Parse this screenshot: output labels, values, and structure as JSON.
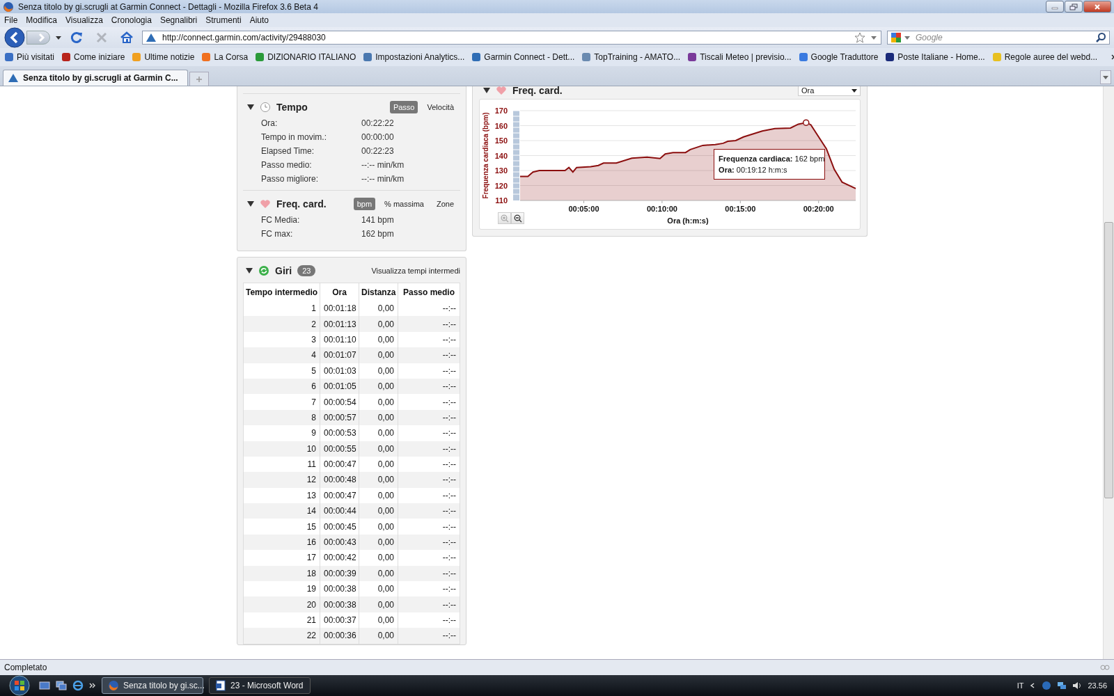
{
  "window": {
    "title": "Senza titolo by gi.scrugli at Garmin Connect - Dettagli - Mozilla Firefox 3.6 Beta 4"
  },
  "menu": [
    "File",
    "Modifica",
    "Visualizza",
    "Cronologia",
    "Segnalibri",
    "Strumenti",
    "Aiuto"
  ],
  "nav": {
    "url": "http://connect.garmin.com/activity/29488030",
    "search_placeholder": "Google"
  },
  "bookmarks": [
    {
      "label": "Più visitati",
      "color": "#3a6fc4"
    },
    {
      "label": "Come iniziare",
      "color": "#b8241c"
    },
    {
      "label": "Ultime notizie",
      "color": "#f0a020"
    },
    {
      "label": "La Corsa",
      "color": "#f07020"
    },
    {
      "label": "DIZIONARIO ITALIANO",
      "color": "#2a9a3a"
    },
    {
      "label": "Impostazioni Analytics...",
      "color": "#4a78b0"
    },
    {
      "label": "Garmin Connect - Dett...",
      "color": "#2f6db5"
    },
    {
      "label": "TopTraining - AMATO...",
      "color": "#6a8ab0"
    },
    {
      "label": "Tiscali Meteo | previsio...",
      "color": "#7a3a9a"
    },
    {
      "label": "Google Traduttore",
      "color": "#3a7ae0"
    },
    {
      "label": "Poste Italiane - Home...",
      "color": "#1a2a7a"
    },
    {
      "label": "Regole auree del webd...",
      "color": "#e8c020"
    }
  ],
  "tabs": [
    {
      "label": "Senza titolo by gi.scrugli at Garmin C...",
      "selected": true
    }
  ],
  "summary": [
    {
      "title": "Tempo",
      "kind": "clock",
      "expanded": true,
      "toggles": [
        {
          "label": "Passo",
          "selected": true
        },
        {
          "label": "Velocità",
          "selected": false
        }
      ],
      "rows": [
        {
          "label": "Ora:",
          "value": "00:22:22"
        },
        {
          "label": "Tempo in movim.:",
          "value": "00:00:00"
        },
        {
          "label": "Elapsed Time:",
          "value": "00:22:23"
        },
        {
          "label": "Passo medio:",
          "value": "--:-- min/km"
        },
        {
          "label": "Passo migliore:",
          "value": "--:-- min/km"
        }
      ]
    },
    {
      "title": "Freq. card.",
      "kind": "heart",
      "expanded": true,
      "toggles": [
        {
          "label": "bpm",
          "selected": true
        },
        {
          "label": "% massima",
          "selected": false
        },
        {
          "label": "Zone",
          "selected": false
        }
      ],
      "rows": [
        {
          "label": "FC Media:",
          "value": "141 bpm"
        },
        {
          "label": "FC max:",
          "value": "162 bpm"
        }
      ]
    }
  ],
  "chart_panel": {
    "title": "Freq. card.",
    "kind": "heart",
    "expanded": true,
    "dropdown": "Ora",
    "tooltip": [
      "**Frequenza cardiaca:** 162 bpm",
      "**Ora:** 00:19:12 h:m:s"
    ],
    "chart_data": {
      "type": "area",
      "xlabel": "Ora (h:m:s)",
      "ylabel": "Frequenza cardiaca (bpm)",
      "x": [
        0.93,
        1.43,
        1.75,
        2.16,
        3.8,
        4.05,
        4.3,
        4.54,
        5.44,
        5.93,
        6.26,
        7.08,
        8.07,
        9.05,
        9.87,
        10.2,
        10.7,
        11.5,
        11.8,
        12.6,
        13.4,
        13.9,
        14.2,
        14.7,
        15.2,
        16.4,
        17.2,
        18.2,
        18.7,
        19.2,
        19.5,
        20.5,
        21,
        21.5,
        22.37
      ],
      "grid": true,
      "series": [
        {
          "color": "#8b0e0e",
          "values": [
            126,
            126,
            129,
            130,
            130,
            132,
            129,
            132,
            132.5,
            133.4,
            135,
            135,
            138.3,
            139,
            138,
            141,
            142,
            142,
            144,
            146.8,
            147.3,
            148.2,
            149.5,
            150,
            152.4,
            156.4,
            158,
            158.4,
            161,
            162,
            160.6,
            144.4,
            130.8,
            122.3,
            118
          ]
        }
      ],
      "xlim": [
        0.93,
        22.37
      ],
      "ylim": [
        110,
        170
      ],
      "xticks": [
        {
          "value": 5,
          "label": "00:05:00"
        },
        {
          "value": 10,
          "label": "00:10:00"
        },
        {
          "value": 15,
          "label": "00:15:00"
        },
        {
          "value": 20,
          "label": "00:20:00"
        }
      ],
      "yticks": [
        110,
        120,
        130,
        140,
        150,
        160,
        170
      ]
    }
  },
  "laps": {
    "title": "Giri",
    "kind": "refresh",
    "expanded": true,
    "count": "23",
    "link": "Visualizza tempi intermedi",
    "columns": [
      "Tempo intermedio",
      "Ora",
      "Distanza",
      "Passo medio"
    ],
    "rows": [
      [
        "1",
        "00:01:18",
        "0,00",
        "--:--"
      ],
      [
        "2",
        "00:01:13",
        "0,00",
        "--:--"
      ],
      [
        "3",
        "00:01:10",
        "0,00",
        "--:--"
      ],
      [
        "4",
        "00:01:07",
        "0,00",
        "--:--"
      ],
      [
        "5",
        "00:01:03",
        "0,00",
        "--:--"
      ],
      [
        "6",
        "00:01:05",
        "0,00",
        "--:--"
      ],
      [
        "7",
        "00:00:54",
        "0,00",
        "--:--"
      ],
      [
        "8",
        "00:00:57",
        "0,00",
        "--:--"
      ],
      [
        "9",
        "00:00:53",
        "0,00",
        "--:--"
      ],
      [
        "10",
        "00:00:55",
        "0,00",
        "--:--"
      ],
      [
        "11",
        "00:00:47",
        "0,00",
        "--:--"
      ],
      [
        "12",
        "00:00:48",
        "0,00",
        "--:--"
      ],
      [
        "13",
        "00:00:47",
        "0,00",
        "--:--"
      ],
      [
        "14",
        "00:00:44",
        "0,00",
        "--:--"
      ],
      [
        "15",
        "00:00:45",
        "0,00",
        "--:--"
      ],
      [
        "16",
        "00:00:43",
        "0,00",
        "--:--"
      ],
      [
        "17",
        "00:00:42",
        "0,00",
        "--:--"
      ],
      [
        "18",
        "00:00:39",
        "0,00",
        "--:--"
      ],
      [
        "19",
        "00:00:38",
        "0,00",
        "--:--"
      ],
      [
        "20",
        "00:00:38",
        "0,00",
        "--:--"
      ],
      [
        "21",
        "00:00:37",
        "0,00",
        "--:--"
      ],
      [
        "22",
        "00:00:36",
        "0,00",
        "--:--"
      ]
    ]
  },
  "status_bar": "Completato",
  "taskbar": {
    "tasks": [
      {
        "label": "Senza titolo by gi.sc...",
        "kind": "firefox",
        "selected": true
      },
      {
        "label": "23 - Microsoft Word",
        "kind": "word",
        "selected": false
      }
    ],
    "language": "IT",
    "clock": "23.56"
  }
}
